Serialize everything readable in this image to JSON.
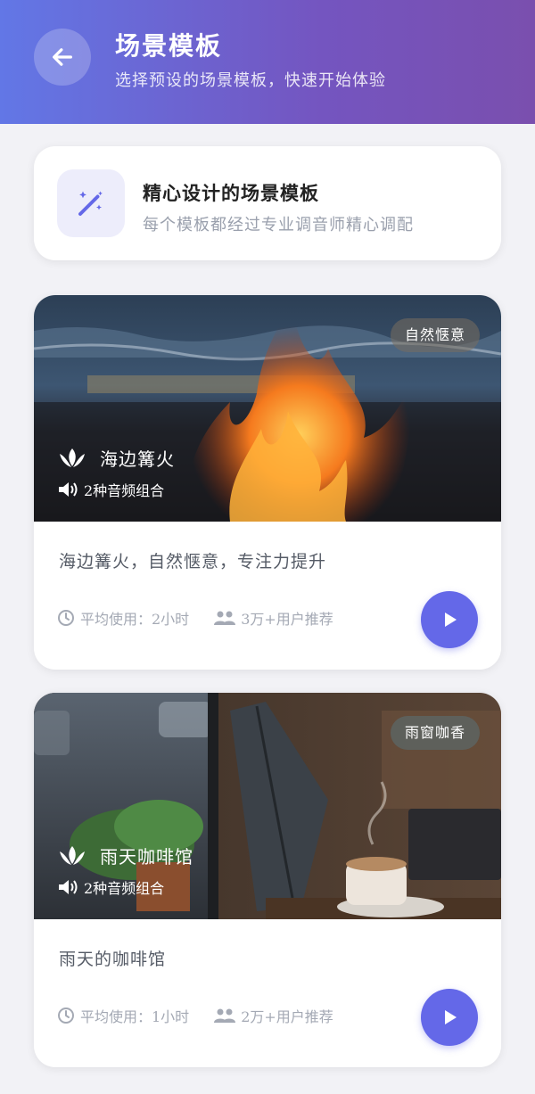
{
  "header": {
    "title": "场景模板",
    "subtitle": "选择预设的场景模板，快速开始体验",
    "back_icon": "arrow-left-icon"
  },
  "intro": {
    "icon": "magic-wand-icon",
    "title": "精心设计的场景模板",
    "subtitle": "每个模板都经过专业调音师精心调配"
  },
  "templates": [
    {
      "name": "海边篝火",
      "tag": "自然惬意",
      "audio_combo": "2种音频组合",
      "description": "海边篝火，自然惬意，专注力提升",
      "avg_use": "平均使用：2小时",
      "recommend": "3万+用户推荐"
    },
    {
      "name": "雨天咖啡馆",
      "tag": "雨窗咖香",
      "audio_combo": "2种音频组合",
      "description": "雨天的咖啡馆",
      "avg_use": "平均使用：1小时",
      "recommend": "2万+用户推荐"
    }
  ],
  "colors": {
    "accent": "#6468e8",
    "header_start": "#6277e6",
    "header_end": "#7a4fae"
  }
}
